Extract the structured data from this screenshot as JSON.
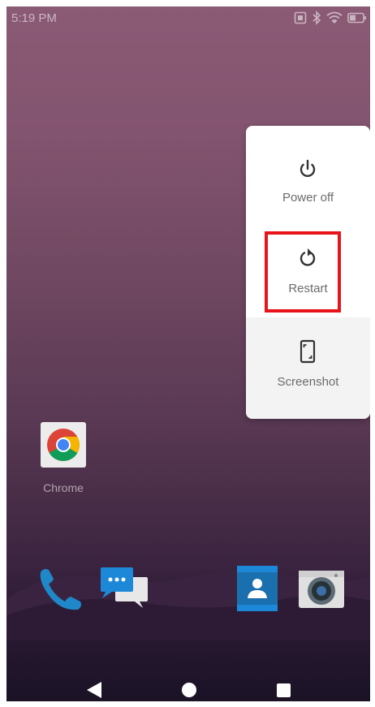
{
  "status_bar": {
    "time": "5:19 PM",
    "icons": [
      "screen-cast-icon",
      "bluetooth-icon",
      "wifi-icon",
      "battery-icon"
    ]
  },
  "power_menu": {
    "items": [
      {
        "label": "Power off",
        "icon": "power-icon"
      },
      {
        "label": "Restart",
        "icon": "restart-icon",
        "highlighted": true
      },
      {
        "label": "Screenshot",
        "icon": "screenshot-icon"
      }
    ],
    "highlight_color": "#e8141a"
  },
  "home": {
    "apps": [
      {
        "label": "Chrome",
        "icon": "chrome-icon"
      }
    ],
    "dock": [
      "phone-icon",
      "messages-icon",
      "contacts-icon",
      "camera-icon"
    ]
  },
  "nav_bar": {
    "buttons": [
      "back-icon",
      "home-icon",
      "recents-icon"
    ]
  }
}
